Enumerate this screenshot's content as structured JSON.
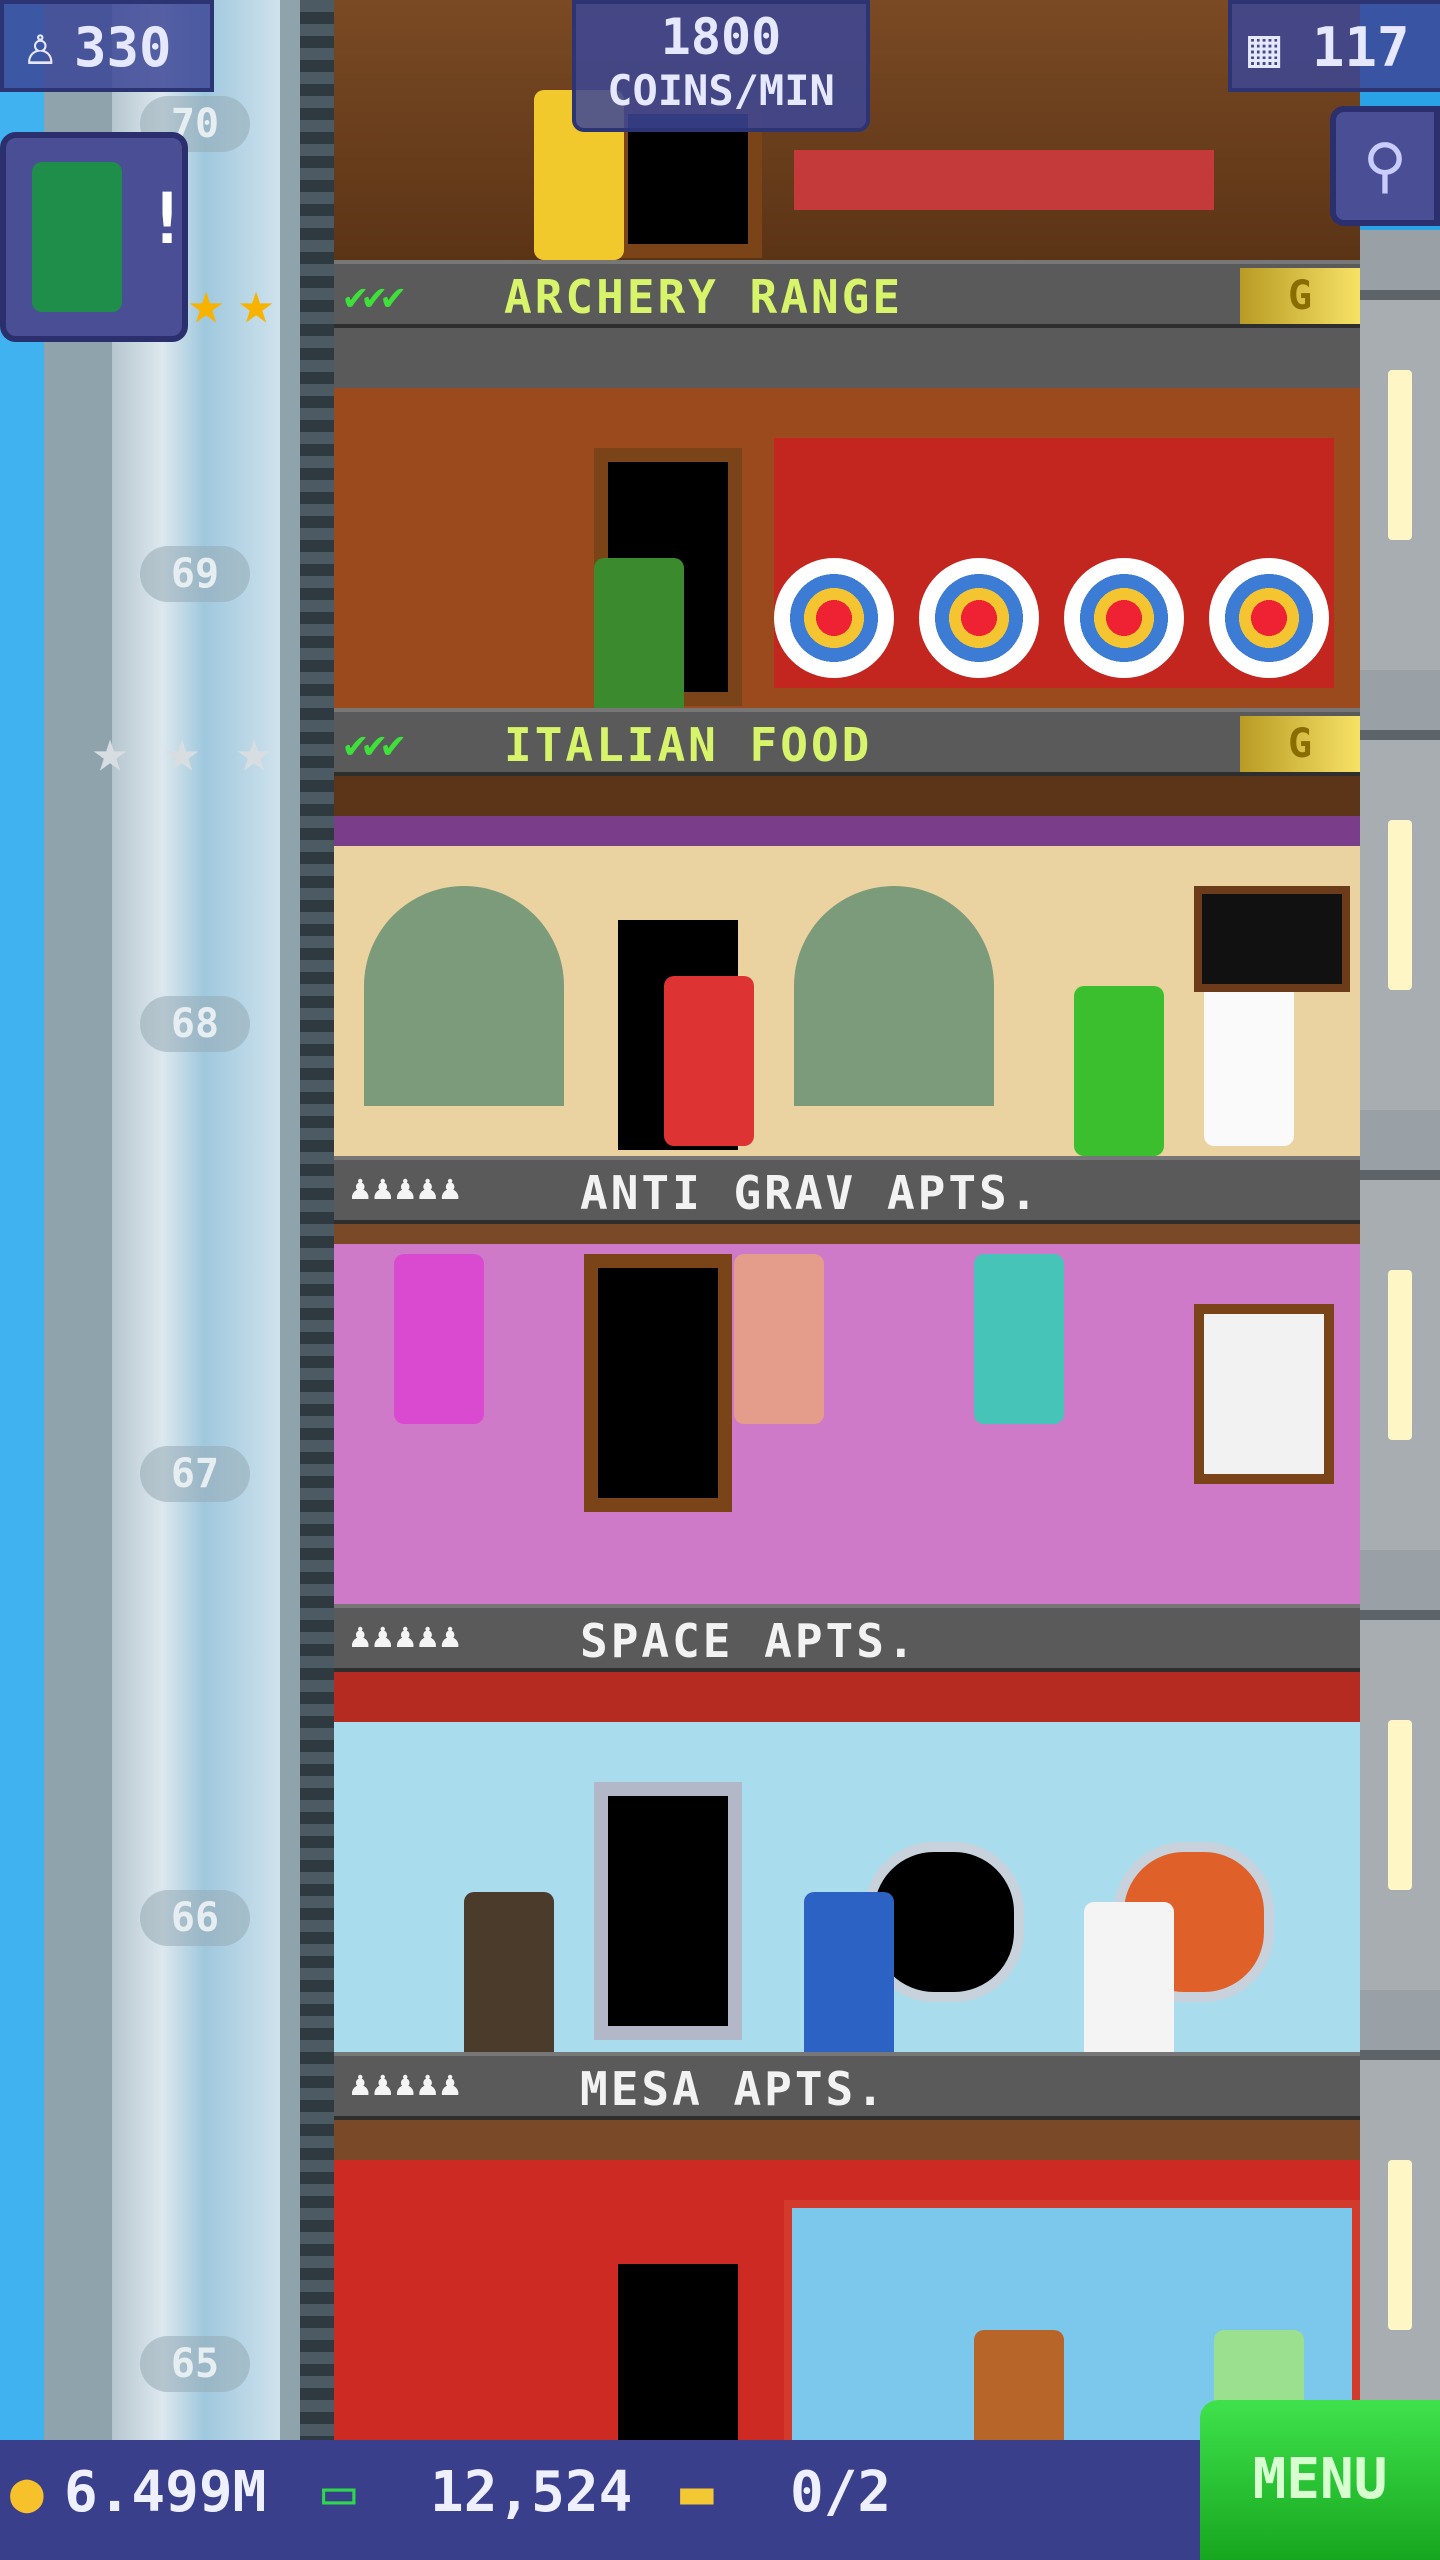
{
  "hud": {
    "population": "330",
    "coins_rate_line1": "1800",
    "coins_rate_line2": "COINS/MIN",
    "floors": "117",
    "coins": "6.499M",
    "bux": "12,524",
    "tickets": "0/2",
    "menu_label": "MENU"
  },
  "elevator": {
    "floor_numbers": [
      "70",
      "69",
      "68",
      "67",
      "66",
      "65"
    ]
  },
  "floors": [
    {
      "name": "ARCHERY RANGE",
      "type": "business",
      "stocked": 3,
      "tag": "G"
    },
    {
      "name": "ITALIAN FOOD",
      "type": "business",
      "stocked": 3,
      "tag": "G"
    },
    {
      "name": "ANTI GRAV APTS.",
      "type": "residential",
      "residents": 5
    },
    {
      "name": "SPACE APTS.",
      "type": "residential",
      "residents": 5
    },
    {
      "name": "MESA APTS.",
      "type": "residential",
      "residents": 5
    }
  ],
  "visitor_alert": "!",
  "icons": {
    "population": "person-icon",
    "floors": "building-icon",
    "search": "magnifier-icon",
    "coin": "coin-icon",
    "bux": "bux-icon",
    "ticket": "ticket-icon",
    "check": "checkmark-icon",
    "star": "star-icon",
    "resident": "person-icon"
  },
  "colors": {
    "check": "#3ee03a",
    "business_title": "#d7f46a",
    "menu": "#22c22f"
  }
}
